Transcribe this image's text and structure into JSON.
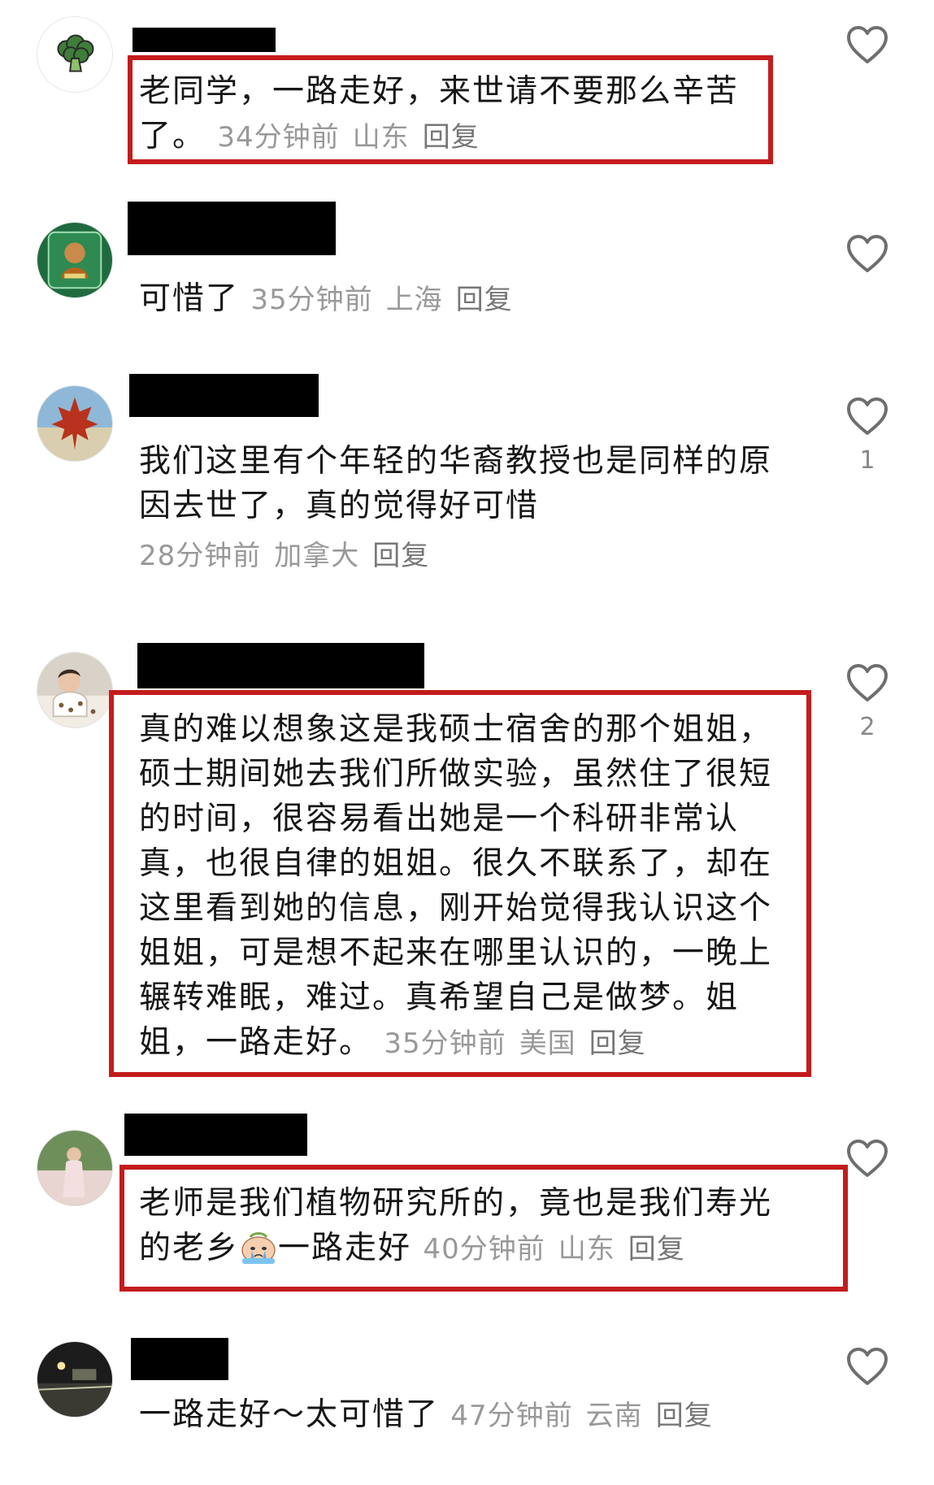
{
  "colors": {
    "highlight": "#c41c1c",
    "meta": "#999999",
    "icon": "#6e6e6e"
  },
  "comments": [
    {
      "text_lines": [
        "老同学，一路走好，来世请不要那么辛苦",
        "了。"
      ],
      "time": "34分钟前",
      "location": "山东",
      "reply": "回复",
      "likes": "",
      "avatar_icon": "broccoli-icon"
    },
    {
      "text_lines": [
        "可惜了"
      ],
      "time": "35分钟前",
      "location": "上海",
      "reply": "回复",
      "likes": "",
      "avatar_icon": "character-avatar"
    },
    {
      "text_lines": [
        "我们这里有个年轻的华裔教授也是同样的原",
        "因去世了，真的觉得好可惜"
      ],
      "time": "28分钟前",
      "location": "加拿大",
      "reply": "回复",
      "likes": "1",
      "avatar_icon": "maple-leaf-avatar"
    },
    {
      "text_lines": [
        "真的难以想象这是我硕士宿舍的那个姐姐，",
        "硕士期间她去我们所做实验，虽然住了很短",
        "的时间，很容易看出她是一个科研非常认",
        "真，也很自律的姐姐。很久不联系了，却在",
        "这里看到她的信息，刚开始觉得我认识这个",
        "姐姐，可是想不起来在哪里认识的，一晚上",
        "辗转难眠，难过。真希望自己是做梦。姐",
        "姐，一路走好。"
      ],
      "time": "35分钟前",
      "location": "美国",
      "reply": "回复",
      "likes": "2",
      "avatar_icon": "baby-photo-avatar"
    },
    {
      "text_lines": [
        "老师是我们植物研究所的，竟也是我们寿光",
        "的老乡",
        "一路走好"
      ],
      "time": "40分钟前",
      "location": "山东",
      "reply": "回复",
      "likes": "",
      "avatar_icon": "person-photo-avatar",
      "emoji_icon": "crying-emoji-icon"
    },
    {
      "text_lines": [
        "一路走好～太可惜了"
      ],
      "time": "47分钟前",
      "location": "云南",
      "reply": "回复",
      "likes": "",
      "avatar_icon": "night-scene-avatar"
    }
  ]
}
